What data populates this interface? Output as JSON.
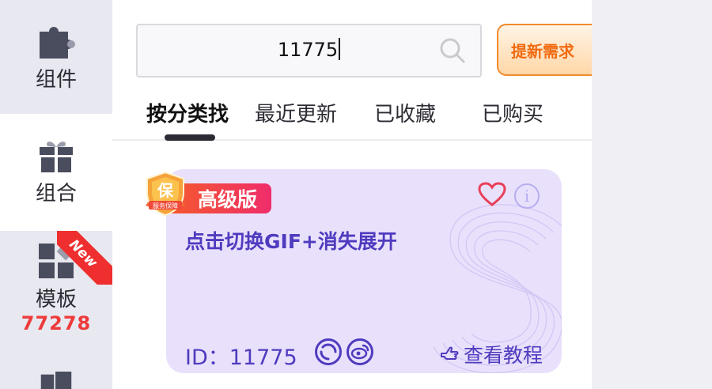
{
  "sidebar": {
    "items": [
      {
        "label": "组件",
        "icon": "puzzle-icon",
        "active": false
      },
      {
        "label": "组合",
        "icon": "gift-icon",
        "active": true
      },
      {
        "label": "模板",
        "icon": "template-grid-icon",
        "active": false,
        "count": "77278",
        "ribbon": "New"
      },
      {
        "label": "",
        "icon": "folder-icon",
        "active": false
      }
    ]
  },
  "search": {
    "value": "11775"
  },
  "request_button": {
    "label": "提新需求"
  },
  "tabs": [
    {
      "label": "按分类找",
      "active": true
    },
    {
      "label": "最近更新",
      "active": false
    },
    {
      "label": "已收藏",
      "active": false
    },
    {
      "label": "已购买",
      "active": false
    }
  ],
  "card": {
    "guarantee_badge": {
      "main": "保",
      "sub": "服务保障"
    },
    "badge": "高级版",
    "title": "点击切换GIF+消失展开",
    "id_text": "ID：11775",
    "tutorial_label": "查看教程",
    "info_glyph": "i",
    "share_icons": [
      "share-icon",
      "weibo-icon"
    ]
  },
  "colors": {
    "accent": "#4f3bbf",
    "card_bg": "#e9e1fc",
    "badge_red": "#ef2d6a",
    "count_red": "#ee3a3a",
    "button_orange": "#f06a10"
  }
}
